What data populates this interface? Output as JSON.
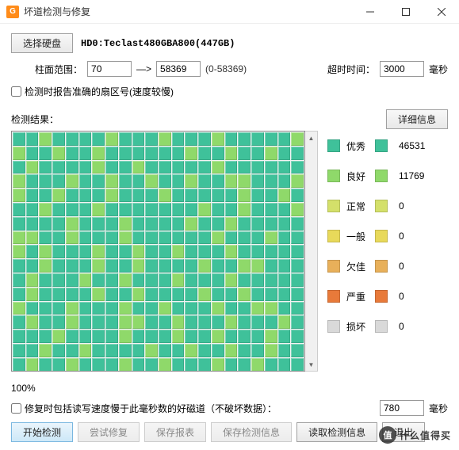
{
  "window": {
    "title": "坏道检测与修复",
    "app_icon": "G"
  },
  "controls": {
    "select_disk_label": "选择硬盘",
    "disk_path": "HD0:Teclast480GBA800(447GB)",
    "cyl_range_label": "柱面范围：",
    "cyl_from": "70",
    "arrow": "—>",
    "cyl_to": "58369",
    "cyl_hint": "(0-58369)",
    "timeout_label": "超时时间：",
    "timeout_value": "3000",
    "timeout_unit": "毫秒",
    "accurate_sector_check": "检测时报告准确的扇区号(速度较慢)",
    "results_label": "检测结果：",
    "detail_btn": "详细信息"
  },
  "legend": [
    {
      "name": "优秀",
      "color": "#3fc19a",
      "count": "46531"
    },
    {
      "name": "良好",
      "color": "#8fd96a",
      "count": "11769"
    },
    {
      "name": "正常",
      "color": "#d4e06a",
      "count": "0"
    },
    {
      "name": "一般",
      "color": "#e8d95a",
      "count": "0"
    },
    {
      "name": "欠佳",
      "color": "#e8b05a",
      "count": "0"
    },
    {
      "name": "严重",
      "color": "#e87a3a",
      "count": "0"
    },
    {
      "name": "损坏",
      "color": "#d9d9d9",
      "count": "0"
    }
  ],
  "progress": "100%",
  "repair": {
    "checkbox_label": "修复时包括读写速度慢于此毫秒数的好磁道（不破坏数据）：",
    "threshold": "780",
    "unit": "毫秒"
  },
  "buttons": {
    "start": "开始检测",
    "try_repair": "尝试修复",
    "save_report": "保存报表",
    "save_info": "保存检测信息",
    "read_info": "读取检测信息",
    "exit": "退出"
  },
  "watermark": {
    "logo": "值",
    "text": "什么值得买"
  },
  "grid_pattern": "EEGEEEEGEEEGEEEGEEEEEGGEEGEEGEEEEEEGEEGEEGEEEGEEEEGEEGEEEEEGEEEEEEGEEEGEEGEEGEEGEEGGEEEGGEEGEEEGEEEGEEEEEGEEGEEEGEEEGEEEEEEEGEEGEEEGEEEEGEEEGEEEEGEEGEEEEEGGEEGEEEGEEEEEEGEEEGEEGEGEEEGEEGEEGEEEGEEEEEEEGEEEGEEGEEEEGEEGGEEEEGEEEGEEGEEEGEEEGEEEEEEGEEEEGEEGEEEEGEEGEEEEGEEEGEEEGEEGEEEGEEGGEEEGEEGEEEGGEEGEEEGEEEGEEEEGEEEEGEEEGEEGEEEGEEEEGEEGEEEEGEEGEEGEEGEEEGEEGEEEGEEGEEEGEEGEEEGEEGGEEEEGEEEGEEEGEE"
}
